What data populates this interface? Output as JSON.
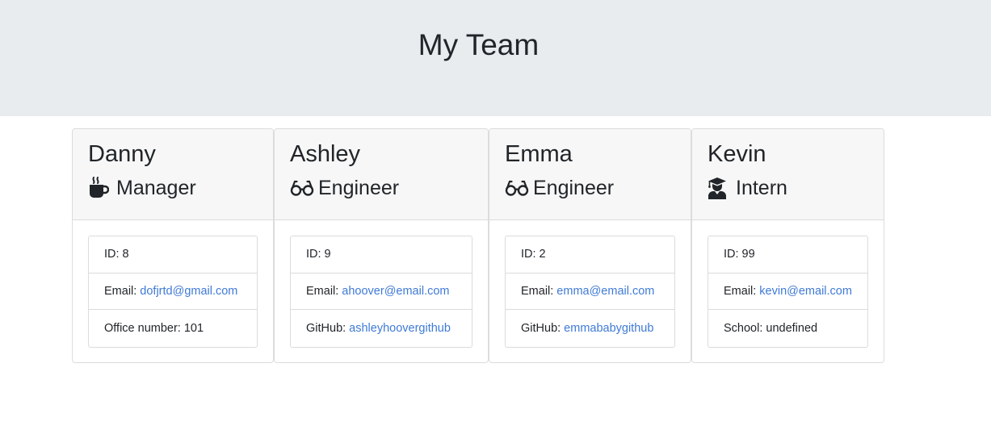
{
  "page": {
    "title": "My Team"
  },
  "team": [
    {
      "name": "Danny",
      "role": "Manager",
      "role_icon": "coffee-icon",
      "details": [
        {
          "label": "ID:",
          "value": "8",
          "link": false
        },
        {
          "label": "Email:",
          "value": "dofjrtd@gmail.com",
          "link": true
        },
        {
          "label": "Office number:",
          "value": "101",
          "link": false
        }
      ]
    },
    {
      "name": "Ashley",
      "role": "Engineer",
      "role_icon": "glasses-icon",
      "details": [
        {
          "label": "ID:",
          "value": "9",
          "link": false
        },
        {
          "label": "Email:",
          "value": "ahoover@email.com",
          "link": true
        },
        {
          "label": "GitHub:",
          "value": "ashleyhoovergithub",
          "link": true
        }
      ]
    },
    {
      "name": "Emma",
      "role": "Engineer",
      "role_icon": "glasses-icon",
      "details": [
        {
          "label": "ID:",
          "value": "2",
          "link": false
        },
        {
          "label": "Email:",
          "value": "emma@email.com",
          "link": true
        },
        {
          "label": "GitHub:",
          "value": "emmababygithub",
          "link": true
        }
      ]
    },
    {
      "name": "Kevin",
      "role": "Intern",
      "role_icon": "graduate-icon",
      "details": [
        {
          "label": "ID:",
          "value": "99",
          "link": false
        },
        {
          "label": "Email:",
          "value": "kevin@email.com",
          "link": true
        },
        {
          "label": "School:",
          "value": "undefined",
          "link": false
        }
      ]
    }
  ],
  "colors": {
    "jumbotron": "#e9ecef",
    "card_header": "#f7f7f7",
    "border": "#dcdcdc",
    "link": "#3f7ad6",
    "text": "#212529"
  }
}
